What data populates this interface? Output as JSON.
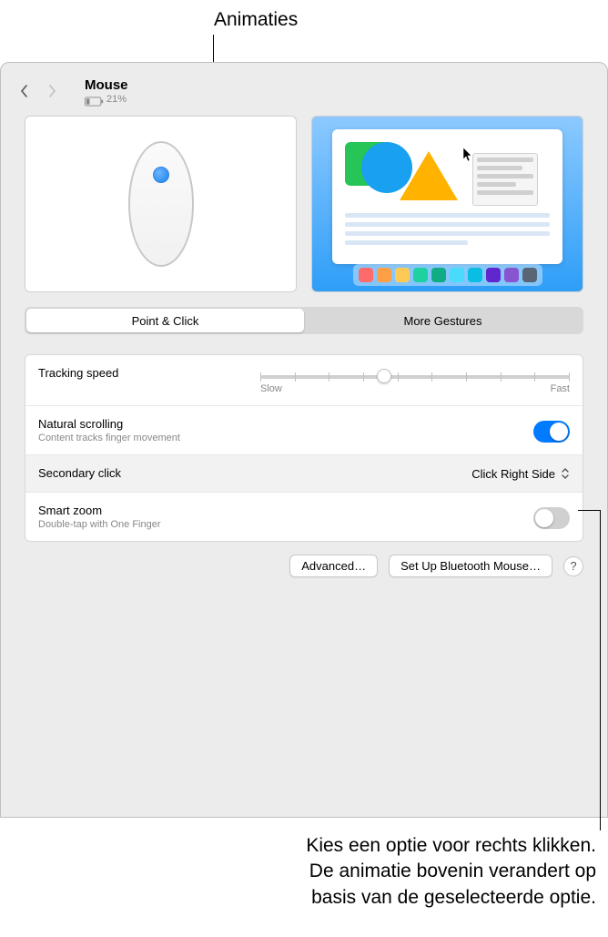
{
  "annotations": {
    "top": "Animaties",
    "bottom_line1": "Kies een optie voor rechts klikken.",
    "bottom_line2": "De animatie bovenin verandert op",
    "bottom_line3": "basis van de geselecteerde optie."
  },
  "header": {
    "title": "Mouse",
    "battery_pct": "21%"
  },
  "tabs": {
    "point_click": "Point & Click",
    "more_gestures": "More Gestures"
  },
  "settings": {
    "tracking": {
      "label": "Tracking speed",
      "slow": "Slow",
      "fast": "Fast"
    },
    "natural_scroll": {
      "label": "Natural scrolling",
      "sub": "Content tracks finger movement"
    },
    "secondary_click": {
      "label": "Secondary click",
      "value": "Click Right Side"
    },
    "smart_zoom": {
      "label": "Smart zoom",
      "sub": "Double-tap with One Finger"
    }
  },
  "buttons": {
    "advanced": "Advanced…",
    "setup_bt": "Set Up Bluetooth Mouse…",
    "help": "?"
  },
  "dock_colors": [
    "#ff6b6b",
    "#ff9f43",
    "#feca57",
    "#1dd1a1",
    "#10ac84",
    "#48dbfb",
    "#0abde3",
    "#5f27cd",
    "#8854d0",
    "#576574"
  ]
}
